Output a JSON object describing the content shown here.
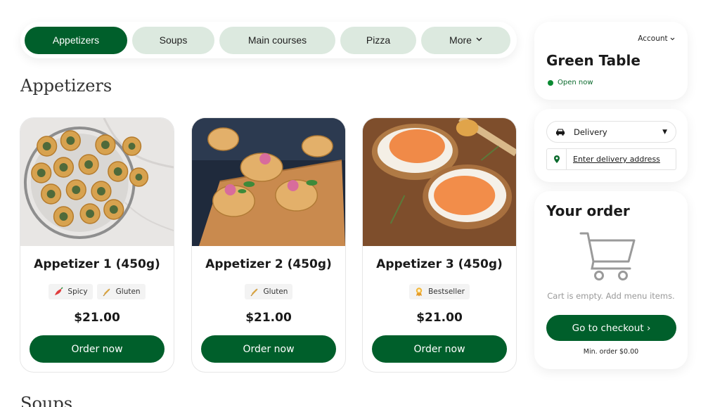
{
  "nav": {
    "categories": [
      {
        "label": "Appetizers",
        "active": true
      },
      {
        "label": "Soups",
        "active": false
      },
      {
        "label": "Main courses",
        "active": false
      },
      {
        "label": "Pizza",
        "active": false
      },
      {
        "label": "More",
        "active": false
      }
    ]
  },
  "sections": {
    "appetizers_title": "Appetizers",
    "soups_title": "Soups"
  },
  "products": [
    {
      "name": "Appetizer 1 (450g)",
      "tags": [
        "Spicy",
        "Gluten"
      ],
      "price": "$21.00",
      "button": "Order now"
    },
    {
      "name": "Appetizer 2 (450g)",
      "tags": [
        "Gluten"
      ],
      "price": "$21.00",
      "button": "Order now"
    },
    {
      "name": "Appetizer 3 (450g)",
      "tags": [
        "Bestseller"
      ],
      "price": "$21.00",
      "button": "Order now"
    }
  ],
  "restaurant": {
    "account_label": "Account",
    "name": "Green Table",
    "status": "Open now"
  },
  "delivery": {
    "mode": "Delivery",
    "address_placeholder": "Enter delivery address"
  },
  "order": {
    "title": "Your order",
    "empty_message": "Cart is empty. Add menu items.",
    "checkout_label": "Go to checkout ›",
    "min_order": "Min. order $0.00"
  },
  "colors": {
    "brand_green": "#005f2b",
    "pill_bg": "#dce9df",
    "status_green": "#0a8a32"
  }
}
